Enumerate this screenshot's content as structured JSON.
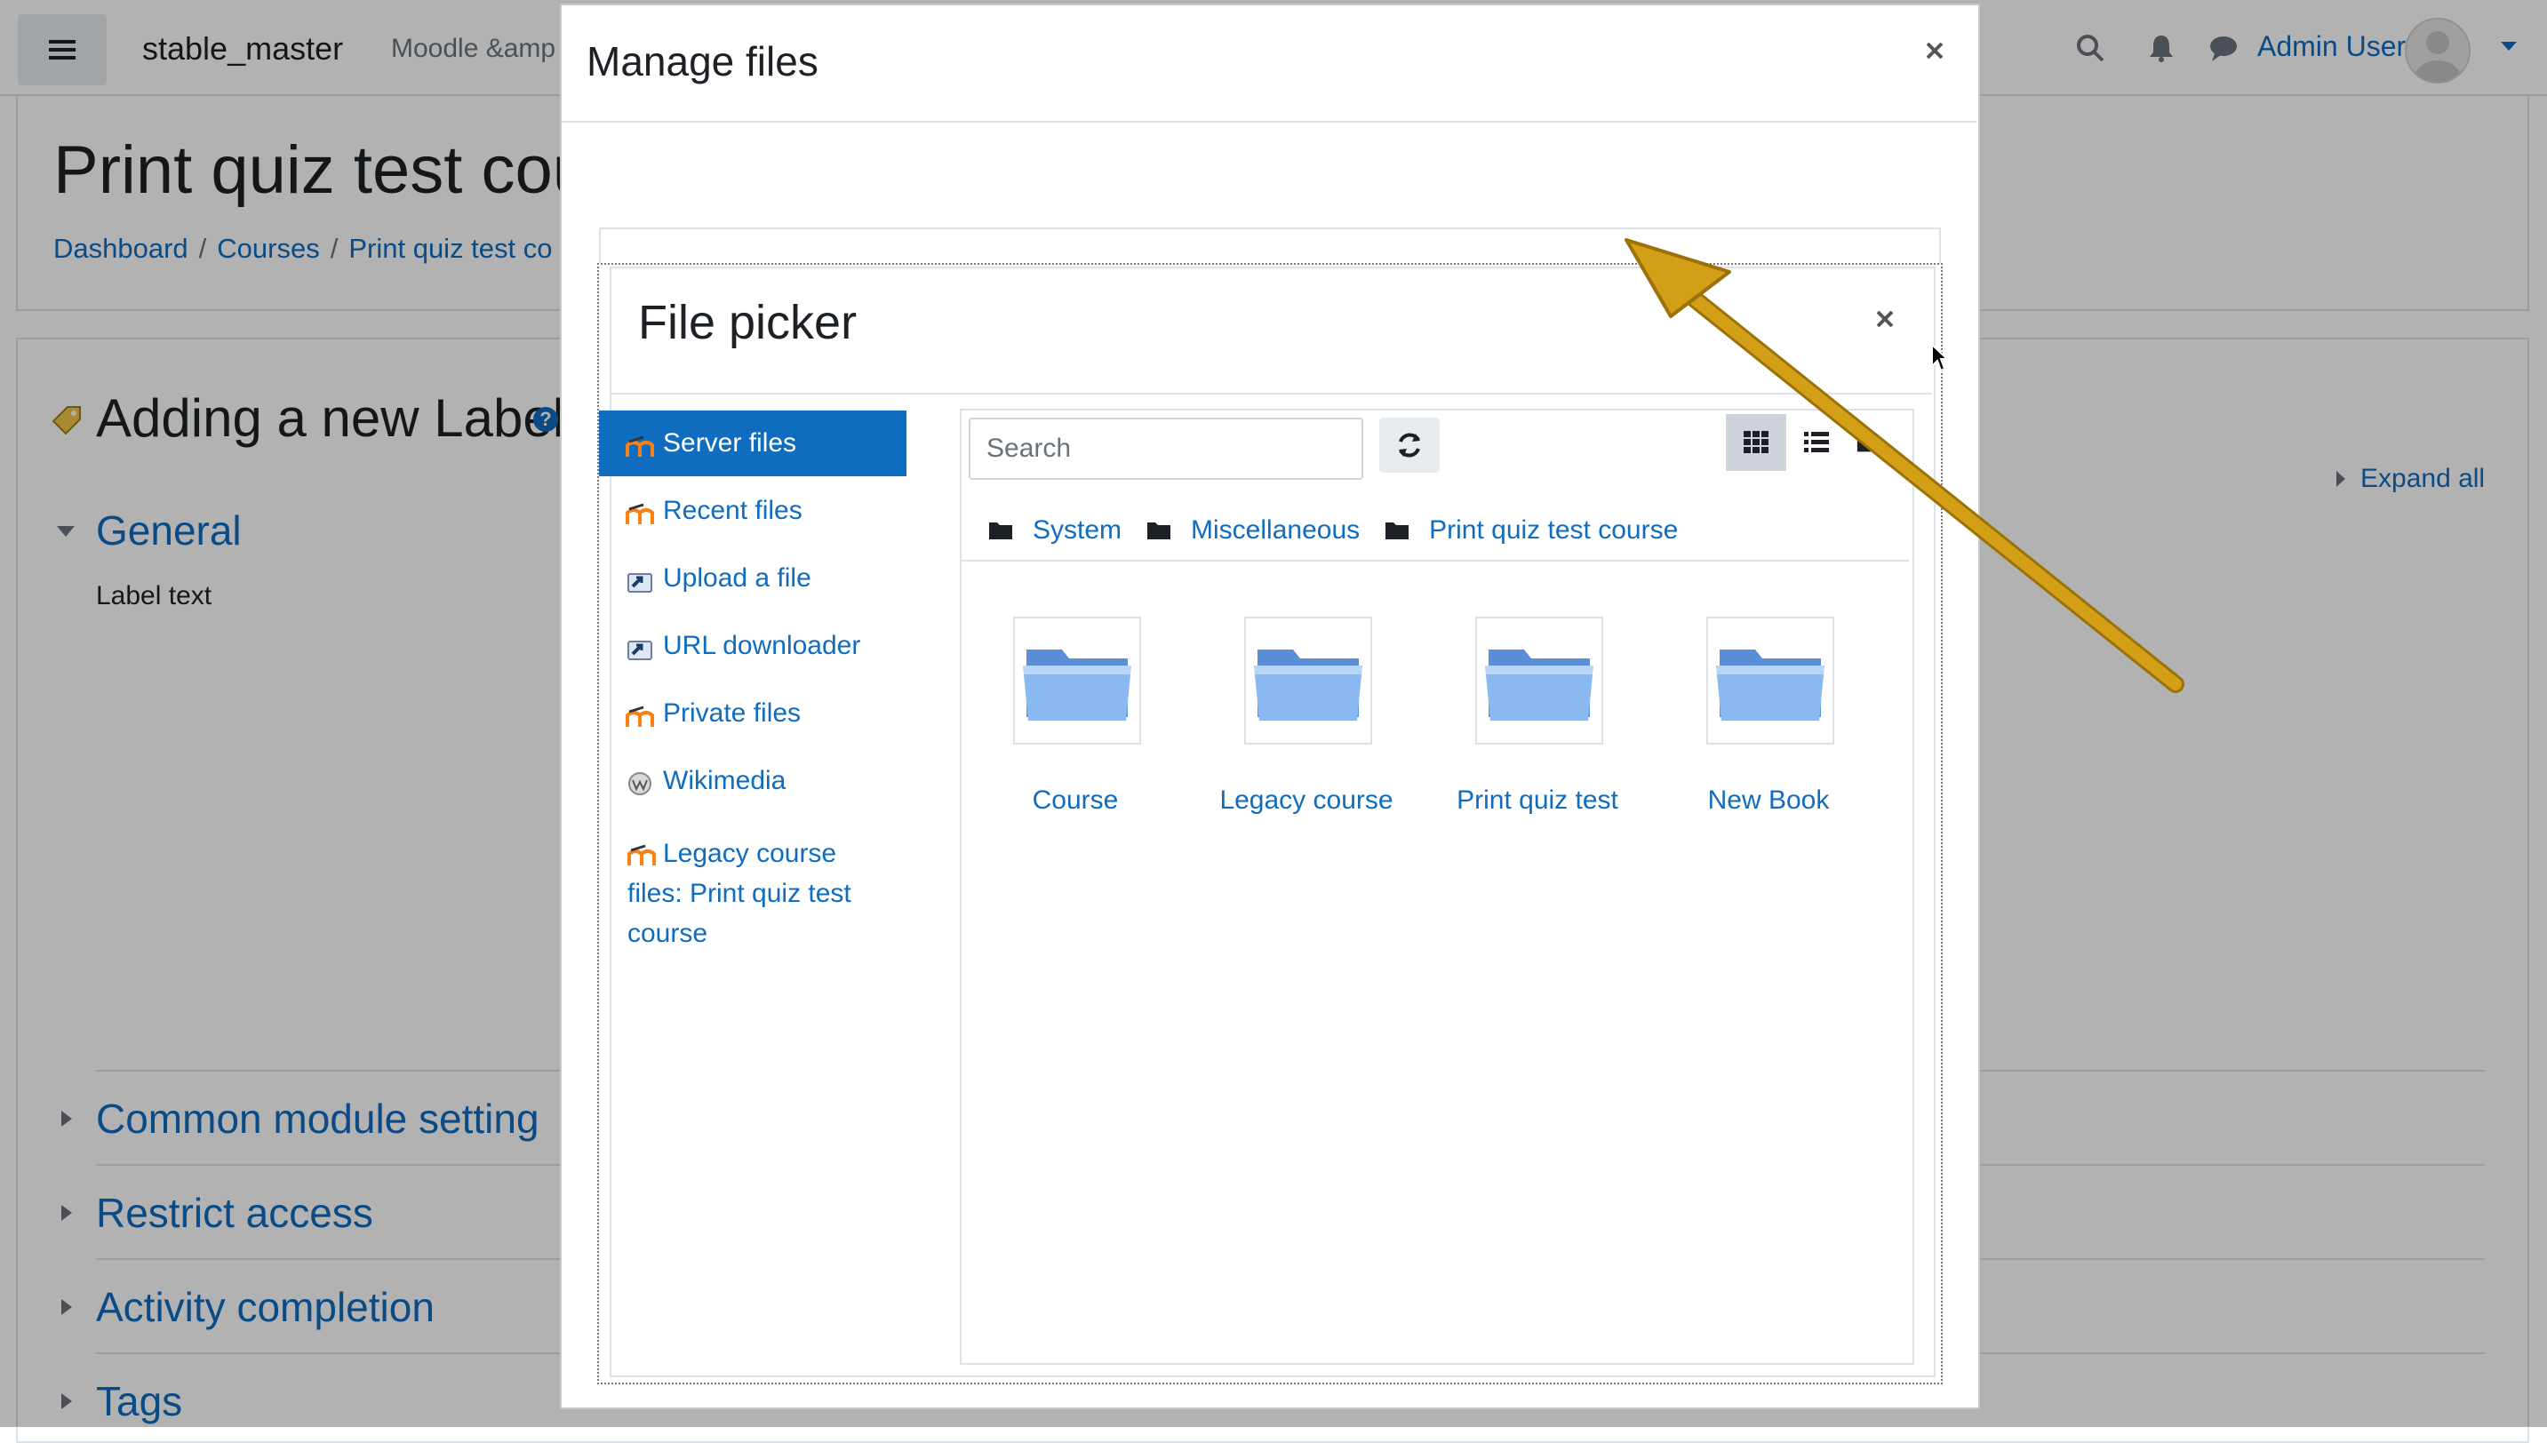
{
  "navbar": {
    "site_name": "stable_master",
    "site_menu_partial": "Moodle &amp",
    "user_name": "Admin User"
  },
  "page": {
    "title_partial": "Print quiz test cour",
    "breadcrumb": [
      "Dashboard",
      "Courses",
      "Print quiz test co"
    ]
  },
  "form": {
    "heading": "Adding a new Label",
    "help_icon": "?",
    "expand_all": "Expand all",
    "general": "General",
    "label_text": "Label text",
    "sections": [
      "Common module setting",
      "Restrict access",
      "Activity completion",
      "Tags"
    ]
  },
  "manage_files": {
    "title": "Manage files"
  },
  "file_picker": {
    "title": "File picker",
    "repositories": [
      {
        "label": "Server files",
        "icon": "moodle-icon",
        "active": true
      },
      {
        "label": "Recent files",
        "icon": "moodle-icon",
        "active": false
      },
      {
        "label": "Upload a file",
        "icon": "upload-icon",
        "active": false
      },
      {
        "label": "URL downloader",
        "icon": "upload-icon",
        "active": false
      },
      {
        "label": "Private files",
        "icon": "moodle-icon",
        "active": false
      },
      {
        "label": "Wikimedia",
        "icon": "wikimedia-icon",
        "active": false
      }
    ],
    "repo_multiline": "Legacy course files: Print quiz test course",
    "search_placeholder": "Search",
    "path": [
      "System",
      "Miscellaneous",
      "Print quiz test course"
    ],
    "folders": [
      "Course",
      "Legacy course",
      "Print quiz test",
      "New Book"
    ]
  },
  "colors": {
    "link": "#0f6cbf",
    "annotation_arrow": "#c99510"
  }
}
